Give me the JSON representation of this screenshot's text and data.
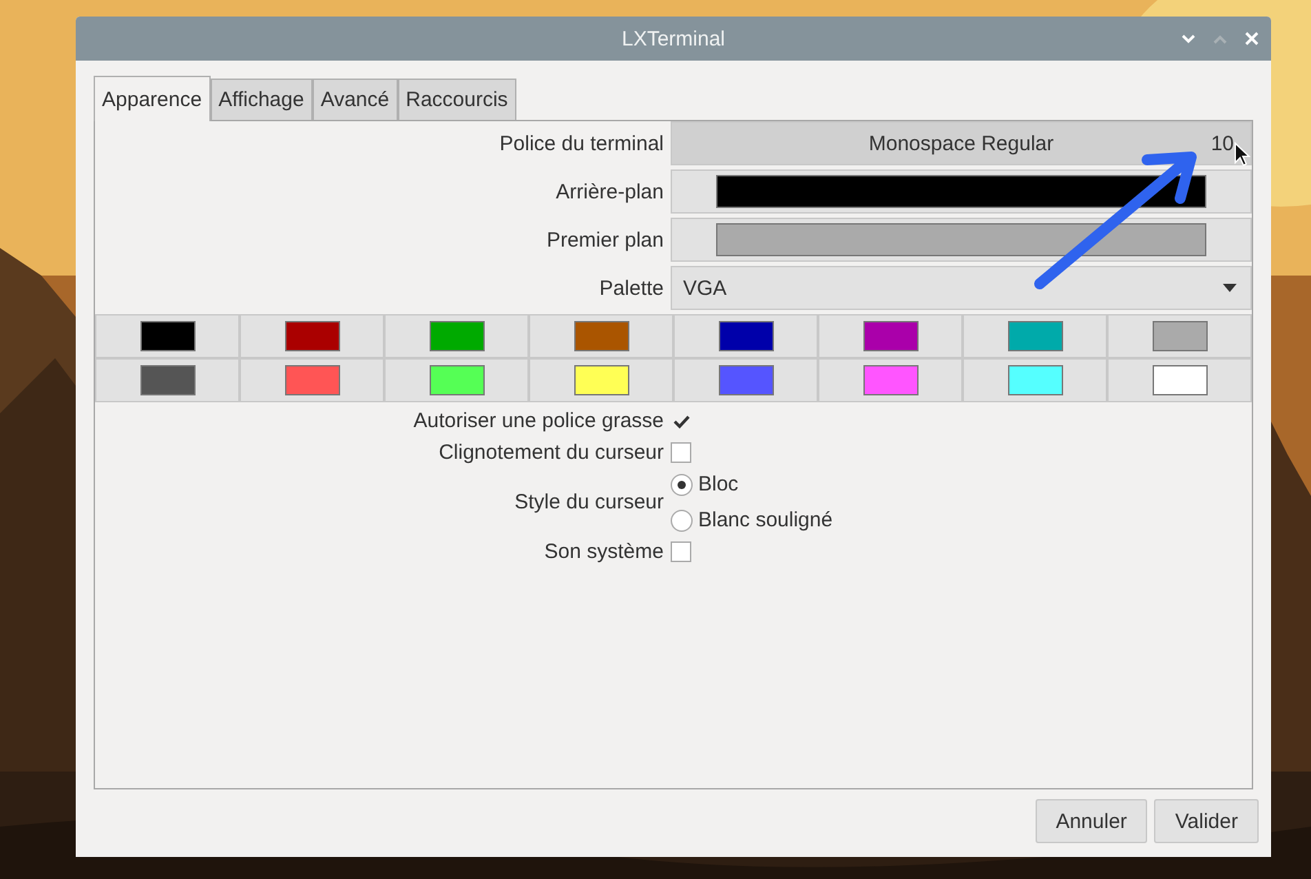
{
  "window": {
    "title": "LXTerminal"
  },
  "tabs": [
    {
      "label": "Apparence",
      "selected": true
    },
    {
      "label": "Affichage",
      "selected": false
    },
    {
      "label": "Avancé",
      "selected": false
    },
    {
      "label": "Raccourcis",
      "selected": false
    }
  ],
  "font": {
    "label": "Police du terminal",
    "name": "Monospace Regular",
    "size": "10"
  },
  "background": {
    "label": "Arrière-plan",
    "color": "#000000"
  },
  "foreground": {
    "label": "Premier plan",
    "color": "#aaaaaa"
  },
  "palette": {
    "label": "Palette",
    "value": "VGA",
    "colors": [
      {
        "color": "#000000"
      },
      {
        "color": "#aa0000"
      },
      {
        "color": "#00aa00"
      },
      {
        "color": "#aa5500"
      },
      {
        "color": "#0000aa"
      },
      {
        "color": "#aa00aa"
      },
      {
        "color": "#00aaaa"
      },
      {
        "color": "#aaaaaa"
      },
      {
        "color": "#555555"
      },
      {
        "color": "#ff5555"
      },
      {
        "color": "#55ff55"
      },
      {
        "color": "#ffff55"
      },
      {
        "color": "#5555ff"
      },
      {
        "color": "#ff55ff"
      },
      {
        "color": "#55ffff"
      },
      {
        "color": "#ffffff"
      }
    ]
  },
  "options": [
    {
      "kind": "checkbox",
      "label": "Autoriser une police grasse",
      "checked": true
    },
    {
      "kind": "checkbox",
      "label": "Clignotement du curseur",
      "checked": false
    },
    {
      "kind": "radio",
      "label": "Style du curseur",
      "choices": [
        {
          "label": "Bloc",
          "selected": true
        },
        {
          "label": "Blanc souligné",
          "selected": false
        }
      ]
    },
    {
      "kind": "checkbox",
      "label": "Son système",
      "checked": false
    }
  ],
  "buttons": [
    "Annuler",
    "Valider"
  ]
}
